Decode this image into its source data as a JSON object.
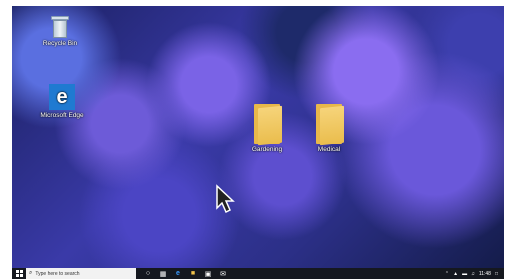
{
  "desktop": {
    "icons": [
      {
        "label": "Recycle Bin"
      },
      {
        "label": "Microsoft Edge"
      },
      {
        "label": "Gardening"
      },
      {
        "label": "Medical"
      }
    ]
  },
  "taskbar": {
    "search_placeholder": "Type here to search",
    "clock": "11:48",
    "pinned": [
      "task-view-icon",
      "edge-icon",
      "file-explorer-icon",
      "store-icon",
      "mail-icon"
    ],
    "tray": [
      "chevron-up-icon",
      "network-icon",
      "volume-icon",
      "notification-icon"
    ]
  }
}
